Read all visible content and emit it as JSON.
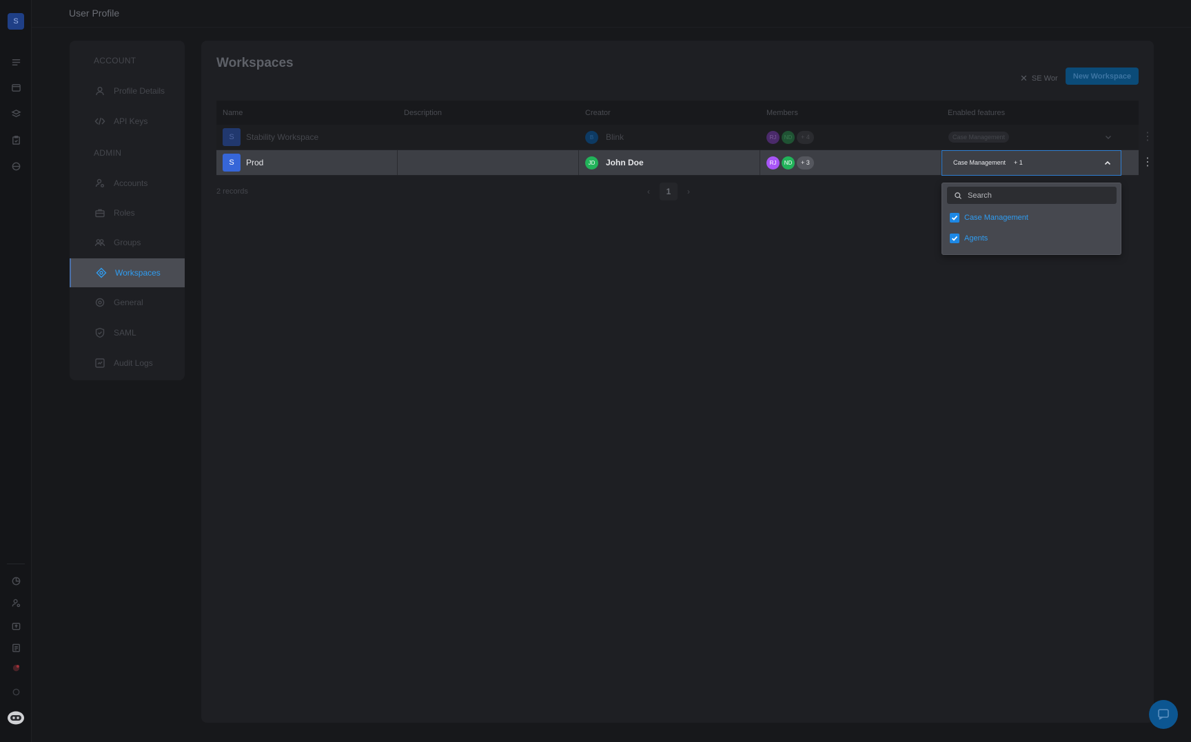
{
  "app": {
    "workspace_initial": "S"
  },
  "topbar": {
    "title": "User Profile"
  },
  "sidebar": {
    "account_section": "ACCOUNT",
    "admin_section": "ADMIN",
    "items": [
      {
        "label": "Profile Details",
        "icon": "user-icon"
      },
      {
        "label": "API Keys",
        "icon": "code-icon"
      },
      {
        "label": "Accounts",
        "icon": "user-gear-icon"
      },
      {
        "label": "Roles",
        "icon": "briefcase-icon"
      },
      {
        "label": "Groups",
        "icon": "users-icon"
      },
      {
        "label": "Workspaces",
        "icon": "workspace-icon",
        "active": true
      },
      {
        "label": "General",
        "icon": "settings-icon"
      },
      {
        "label": "SAML",
        "icon": "shield-icon"
      },
      {
        "label": "Audit Logs",
        "icon": "audit-icon"
      }
    ]
  },
  "main": {
    "title": "Workspaces",
    "filter_chip": "SE Wor",
    "new_button": "New Workspace",
    "columns": [
      "Name",
      "Description",
      "Creator",
      "Members",
      "Enabled features"
    ],
    "rows": [
      {
        "initial": "S",
        "name": "Stability Workspace",
        "description": "",
        "creator_initial": "B",
        "creator": "Blink",
        "members": [
          "RJ",
          "ND"
        ],
        "members_more": "+ 4",
        "features": "Case Management",
        "features_more": ""
      },
      {
        "initial": "S",
        "name": "Prod",
        "description": "",
        "creator_initial": "JD",
        "creator": "John Doe",
        "members": [
          "RJ",
          "ND"
        ],
        "members_more": "+ 3",
        "features": "Case Management",
        "features_more": "+ 1"
      }
    ],
    "records": "2 records",
    "page": "1"
  },
  "dropdown": {
    "search_placeholder": "Search",
    "options": [
      {
        "label": "Case Management",
        "checked": true
      },
      {
        "label": "Agents",
        "checked": true
      }
    ]
  },
  "colors": {
    "accent": "#2f9df2",
    "checkbox": "#1d88e5",
    "avatar_purple": "#a855f7",
    "avatar_green": "#22b35a"
  }
}
